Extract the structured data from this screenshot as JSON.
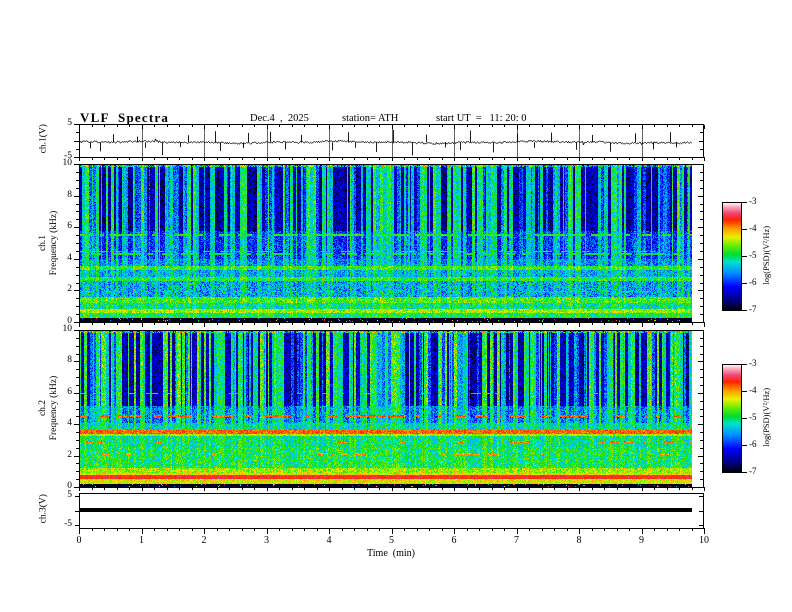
{
  "header": {
    "title": "VLF  Spectra",
    "date": "Dec.4  ,  2025",
    "station": "station= ATH",
    "start_ut": "start UT  =   11: 20: 0"
  },
  "axes": {
    "time": {
      "label": "Time  (min)",
      "ticks": [
        "0",
        "1",
        "2",
        "3",
        "4",
        "5",
        "6",
        "7",
        "8",
        "9",
        "10"
      ],
      "range": [
        0,
        10
      ],
      "minor_step": 0.2
    },
    "ch1v": {
      "label": "ch.1(V)",
      "ticks": [
        "5",
        "-5"
      ],
      "tick_values": [
        5,
        -5
      ],
      "range": [
        -5,
        5
      ]
    },
    "spec1": {
      "labels": [
        "ch.1",
        "Frequency (kHz)"
      ],
      "ticks": [
        "10",
        "8",
        "6",
        "4",
        "2",
        "0"
      ],
      "range": [
        0,
        10
      ],
      "minor_step": 0.5
    },
    "spec2": {
      "labels": [
        "ch.2",
        "Frequency (kHz)"
      ],
      "ticks": [
        "10",
        "8",
        "6",
        "4",
        "2",
        "0"
      ],
      "range": [
        0,
        10
      ],
      "minor_step": 0.5
    },
    "ch3v": {
      "label": "ch.3(V)",
      "ticks": [
        "5",
        "-5"
      ],
      "tick_values": [
        5,
        -5
      ],
      "range": [
        -5,
        5
      ]
    }
  },
  "colorbar": {
    "label": "log(PSD)(V²/Hz)",
    "ticks": [
      "-3",
      "-4",
      "-5",
      "-6",
      "-7"
    ],
    "range": [
      -7,
      -3
    ]
  },
  "chart_data": [
    {
      "type": "line",
      "name": "ch.1 voltage waveform",
      "ylabel": "ch.1(V)",
      "xlabel": "Time (min)",
      "xrange": [
        0,
        10
      ],
      "yrange": [
        -5,
        5
      ],
      "duration_min": 9.8,
      "baseline_v": -0.55,
      "noise_v": 0.3,
      "seed": 20251204,
      "grid_minutes": true,
      "spikes_down": [
        [
          0.18,
          -2.4
        ],
        [
          0.33,
          -3.3
        ],
        [
          1.05,
          -2.2
        ],
        [
          1.32,
          -4.4
        ],
        [
          1.62,
          -2.0
        ],
        [
          2.25,
          -3.2
        ],
        [
          2.62,
          -2.3
        ],
        [
          3.3,
          -2.7
        ],
        [
          4.05,
          -3.0
        ],
        [
          4.42,
          -2.2
        ],
        [
          4.75,
          -3.5
        ],
        [
          5.32,
          -4.5
        ],
        [
          5.85,
          -2.1
        ],
        [
          6.1,
          -2.9
        ],
        [
          6.63,
          -3.6
        ],
        [
          7.28,
          -2.2
        ],
        [
          7.95,
          -2.8
        ],
        [
          8.5,
          -3.4
        ],
        [
          9.18,
          -2.7
        ],
        [
          9.55,
          -2.1
        ]
      ],
      "spikes_up": [
        [
          0.55,
          1.9
        ],
        [
          0.92,
          1.2
        ],
        [
          1.75,
          1.6
        ],
        [
          2.18,
          2.8
        ],
        [
          2.7,
          2.3
        ],
        [
          3.05,
          2.6
        ],
        [
          3.55,
          1.7
        ],
        [
          4.3,
          2.5
        ],
        [
          5.02,
          3.2
        ],
        [
          5.55,
          1.8
        ],
        [
          6.25,
          3.0
        ],
        [
          7.0,
          2.1
        ],
        [
          7.55,
          2.4
        ],
        [
          8.2,
          1.7
        ],
        [
          8.9,
          2.2
        ],
        [
          9.45,
          2.5
        ]
      ]
    },
    {
      "type": "heatmap",
      "name": "ch.1 spectrogram",
      "ylabel": "Frequency (kHz)",
      "xlabel": "Time (min)",
      "xrange": [
        0,
        10
      ],
      "yrange": [
        0,
        10
      ],
      "duration_min": 9.8,
      "value_label": "log(PSD)(V²/Hz)",
      "value_range": [
        -7,
        -3
      ],
      "seed": 12345,
      "colorscale": [
        [
          0,
          "#000000"
        ],
        [
          0.1,
          "#00008a"
        ],
        [
          0.22,
          "#0000ff"
        ],
        [
          0.35,
          "#0090ff"
        ],
        [
          0.45,
          "#00e0cc"
        ],
        [
          0.52,
          "#00dd33"
        ],
        [
          0.6,
          "#66ee00"
        ],
        [
          0.68,
          "#eeee00"
        ],
        [
          0.76,
          "#ff9900"
        ],
        [
          0.84,
          "#ff2200"
        ],
        [
          0.9,
          "#ee4477"
        ],
        [
          0.96,
          "#ffaabb"
        ],
        [
          1,
          "#ffffff"
        ]
      ],
      "bands": [
        {
          "f0": 9.87,
          "f1": 10.01,
          "base": 0.45,
          "stripe": 0.3,
          "noise": 0.22
        },
        {
          "f0": 5.8,
          "f1": 9.87,
          "base": 0.33,
          "stripe": 0.56,
          "noise": 0.1
        },
        {
          "f0": 4.0,
          "f1": 5.8,
          "base": 0.37,
          "stripe": 0.34,
          "noise": 0.11
        },
        {
          "f0": 3.55,
          "f1": 4.0,
          "base": 0.4,
          "stripe": 0.2,
          "noise": 0.1
        },
        {
          "f0": 3.3,
          "f1": 3.55,
          "base": 0.56,
          "stripe": 0.1,
          "noise": 0.08
        },
        {
          "f0": 2.9,
          "f1": 3.3,
          "base": 0.42,
          "stripe": 0.15,
          "noise": 0.11
        },
        {
          "f0": 2.6,
          "f1": 2.9,
          "base": 0.54,
          "stripe": 0.08,
          "noise": 0.09
        },
        {
          "f0": 1.6,
          "f1": 2.6,
          "base": 0.41,
          "stripe": 0.14,
          "noise": 0.13
        },
        {
          "f0": 1.25,
          "f1": 1.6,
          "base": 0.57,
          "stripe": 0.07,
          "noise": 0.09
        },
        {
          "f0": 0.85,
          "f1": 1.25,
          "base": 0.49,
          "stripe": 0.08,
          "noise": 0.11
        },
        {
          "f0": 0.6,
          "f1": 0.85,
          "base": 0.63,
          "stripe": 0.05,
          "noise": 0.08
        },
        {
          "f0": 0.28,
          "f1": 0.6,
          "base": 0.52,
          "stripe": 0.06,
          "noise": 0.09
        },
        {
          "f0": -0.1,
          "f1": 0.28,
          "base": 0.02,
          "stripe": 0,
          "noise": 0.02,
          "speckle_p": 0.05
        }
      ],
      "lines": [
        {
          "f": 5.55,
          "hw": 0.05,
          "v": 0.55,
          "p": 0.7
        },
        {
          "f": 4.5,
          "hw": 0.04,
          "v": 0.56,
          "p": 0.5
        },
        {
          "f": 4.33,
          "hw": 0.04,
          "v": 0.52,
          "p": 0.5
        },
        {
          "f": 1.95,
          "hw": 0.04,
          "v": 0.55,
          "p": 0.4
        },
        {
          "f": 1.45,
          "hw": 0.04,
          "v": 0.6,
          "p": 0.5
        }
      ]
    },
    {
      "type": "heatmap",
      "name": "ch.2 spectrogram",
      "ylabel": "Frequency (kHz)",
      "xlabel": "Time (min)",
      "xrange": [
        0,
        10
      ],
      "yrange": [
        0,
        10
      ],
      "duration_min": 9.8,
      "value_label": "log(PSD)(V²/Hz)",
      "value_range": [
        -7,
        -3
      ],
      "seed": 98765,
      "colorscale": [
        [
          0,
          "#000000"
        ],
        [
          0.1,
          "#00008a"
        ],
        [
          0.22,
          "#0000ff"
        ],
        [
          0.35,
          "#0090ff"
        ],
        [
          0.45,
          "#00e0cc"
        ],
        [
          0.52,
          "#00dd33"
        ],
        [
          0.6,
          "#66ee00"
        ],
        [
          0.68,
          "#eeee00"
        ],
        [
          0.76,
          "#ff9900"
        ],
        [
          0.84,
          "#ff2200"
        ],
        [
          0.9,
          "#ee4477"
        ],
        [
          0.96,
          "#ffaabb"
        ],
        [
          1,
          "#ffffff"
        ]
      ],
      "bands": [
        {
          "f0": 9.87,
          "f1": 10.01,
          "base": 0.48,
          "stripe": 0.3,
          "noise": 0.22
        },
        {
          "f0": 5.2,
          "f1": 9.87,
          "base": 0.36,
          "stripe": 0.6,
          "noise": 0.1
        },
        {
          "f0": 4.1,
          "f1": 5.2,
          "base": 0.42,
          "stripe": 0.28,
          "noise": 0.11
        },
        {
          "f0": 3.66,
          "f1": 4.1,
          "base": 0.47,
          "stripe": 0.12,
          "noise": 0.1
        },
        {
          "f0": 3.42,
          "f1": 3.66,
          "base": 0.8,
          "stripe": 0.03,
          "noise": 0.05
        },
        {
          "f0": 3.3,
          "f1": 3.42,
          "base": 0.64,
          "stripe": 0.05,
          "noise": 0.08
        },
        {
          "f0": 2.6,
          "f1": 3.3,
          "base": 0.5,
          "stripe": 0.09,
          "noise": 0.1
        },
        {
          "f0": 1.25,
          "f1": 2.6,
          "base": 0.52,
          "stripe": 0.08,
          "noise": 0.1
        },
        {
          "f0": 0.9,
          "f1": 1.25,
          "base": 0.63,
          "stripe": 0.05,
          "noise": 0.09
        },
        {
          "f0": 0.78,
          "f1": 0.9,
          "base": 0.7,
          "stripe": 0.03,
          "noise": 0.07
        },
        {
          "f0": 0.52,
          "f1": 0.78,
          "base": 0.85,
          "stripe": 0.02,
          "noise": 0.04
        },
        {
          "f0": 0.22,
          "f1": 0.52,
          "base": 0.68,
          "stripe": 0.04,
          "noise": 0.08
        },
        {
          "f0": -0.1,
          "f1": 0.22,
          "base": 0.02,
          "stripe": 0,
          "noise": 0.02,
          "speckle_p": 0.05
        }
      ],
      "lines": [
        {
          "f": 6.0,
          "hw": 0.04,
          "v": 0.55,
          "p": 0.3
        },
        {
          "f": 4.55,
          "hw": 0.05,
          "v": 0.8,
          "p": 0.45
        },
        {
          "f": 2.9,
          "hw": 0.05,
          "v": 0.78,
          "p": 0.22
        },
        {
          "f": 2.15,
          "hw": 0.05,
          "v": 0.76,
          "p": 0.18
        }
      ]
    },
    {
      "type": "line",
      "name": "ch.3 voltage waveform",
      "ylabel": "ch.3(V)",
      "xlabel": "Time (min)",
      "xrange": [
        0,
        10
      ],
      "yrange": [
        -5,
        5
      ],
      "duration_min": 9.78,
      "constant_v": 0
    }
  ]
}
